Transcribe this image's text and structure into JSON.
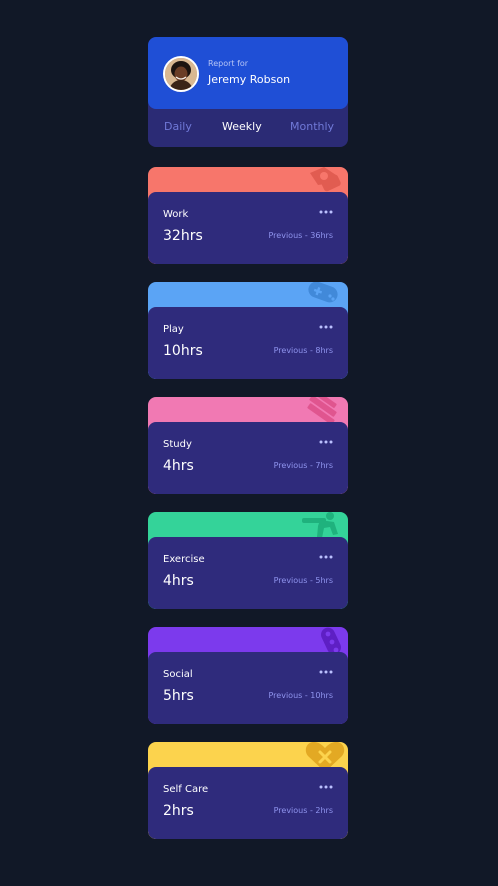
{
  "profile": {
    "report_for": "Report for",
    "name": "Jeremy Robson"
  },
  "tabs": [
    {
      "label": "Daily",
      "active": false
    },
    {
      "label": "Weekly",
      "active": true
    },
    {
      "label": "Monthly",
      "active": false
    }
  ],
  "cards": [
    {
      "title": "Work",
      "current": "32hrs",
      "previous": "Previous - 36hrs",
      "color": "#f7766b",
      "icon": "work-icon"
    },
    {
      "title": "Play",
      "current": "10hrs",
      "previous": "Previous - 8hrs",
      "color": "#5ba4f5",
      "icon": "play-icon"
    },
    {
      "title": "Study",
      "current": "4hrs",
      "previous": "Previous - 7hrs",
      "color": "#f179b3",
      "icon": "study-icon"
    },
    {
      "title": "Exercise",
      "current": "4hrs",
      "previous": "Previous - 5hrs",
      "color": "#34d399",
      "icon": "exercise-icon"
    },
    {
      "title": "Social",
      "current": "5hrs",
      "previous": "Previous - 10hrs",
      "color": "#7c3aed",
      "icon": "social-icon"
    },
    {
      "title": "Self Care",
      "current": "2hrs",
      "previous": "Previous - 2hrs",
      "color": "#fcd34d",
      "icon": "self-care-icon"
    }
  ],
  "colors": {
    "page_bg": "#111827",
    "profile_accent": "#1f4fd6",
    "card_body": "#2f2b7c",
    "muted_text": "#8f94ee"
  }
}
